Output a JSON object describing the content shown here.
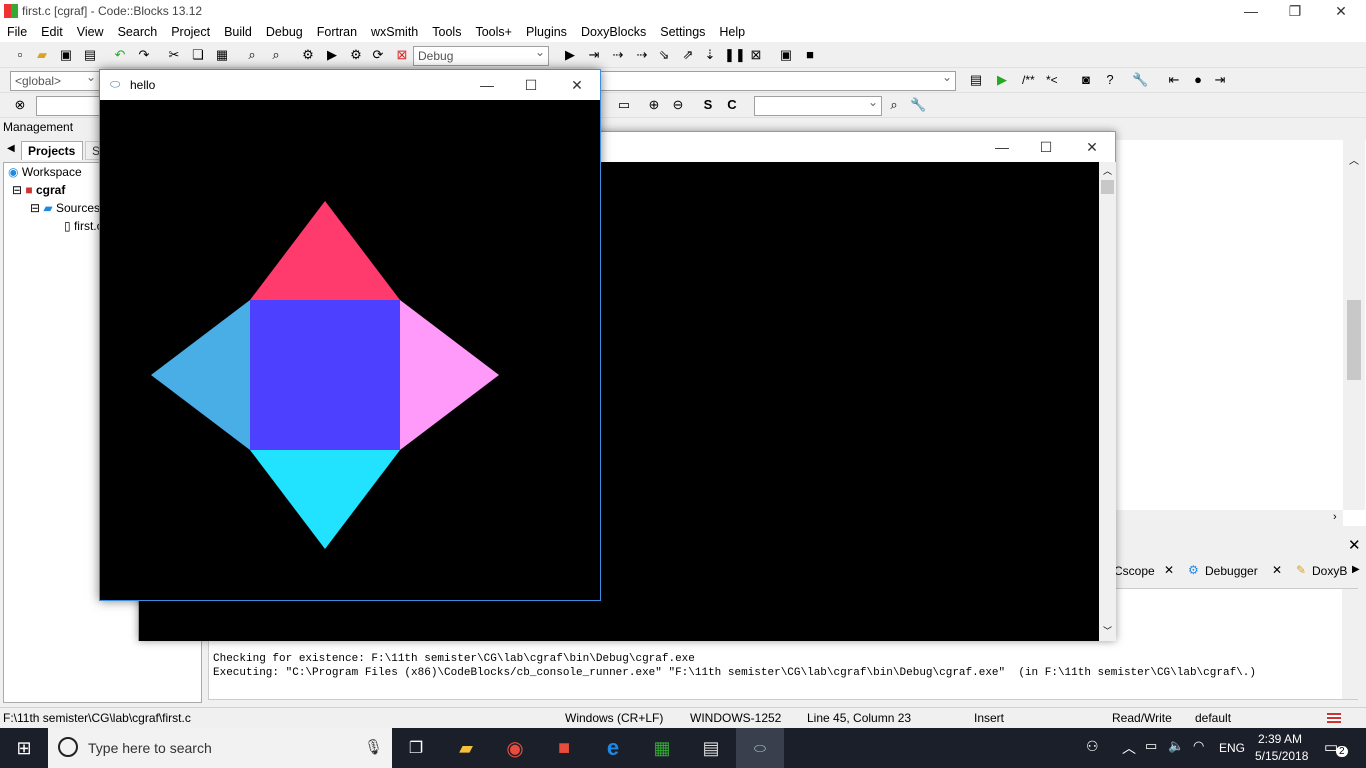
{
  "window": {
    "title": "first.c [cgraf] - Code::Blocks 13.12"
  },
  "menu": [
    "File",
    "Edit",
    "View",
    "Search",
    "Project",
    "Build",
    "Debug",
    "Fortran",
    "wxSmith",
    "Tools",
    "Tools+",
    "Plugins",
    "DoxyBlocks",
    "Settings",
    "Help"
  ],
  "toolbar": {
    "build_target": "Debug",
    "scope": "<global>",
    "doc_comment_1": "/**",
    "doc_comment_2": "*<"
  },
  "management": {
    "title": "Management",
    "tabs": [
      "Projects",
      "Sy"
    ],
    "tree": [
      "Workspace",
      "cgraf",
      "Sources",
      "first.c"
    ]
  },
  "hello_window": {
    "title": "hello"
  },
  "shapes": {
    "top": "#ff3b6e",
    "center": "#4e40ff",
    "left": "#4aaee6",
    "right": "#ff99fa",
    "bottom": "#22e3ff"
  },
  "log_tabs": [
    "Cscope",
    "Debugger",
    "DoxyB"
  ],
  "log": [
    "Checking for existence: F:\\11th semister\\CG\\lab\\cgraf\\bin\\Debug\\cgraf.exe",
    "Executing: \"C:\\Program Files (x86)\\CodeBlocks/cb_console_runner.exe\" \"F:\\11th semister\\CG\\lab\\cgraf\\bin\\Debug\\cgraf.exe\"  (in F:\\11th semister\\CG\\lab\\cgraf\\.)"
  ],
  "status": {
    "path": "F:\\11th semister\\CG\\lab\\cgraf\\first.c",
    "eol": "Windows (CR+LF)",
    "encoding": "WINDOWS-1252",
    "position": "Line 45, Column 23",
    "mode": "Insert",
    "access": "Read/Write",
    "profile": "default"
  },
  "taskbar": {
    "search_placeholder": "Type here to search",
    "lang": "ENG",
    "time": "2:39 AM",
    "date": "5/15/2018",
    "notifications": "2"
  }
}
